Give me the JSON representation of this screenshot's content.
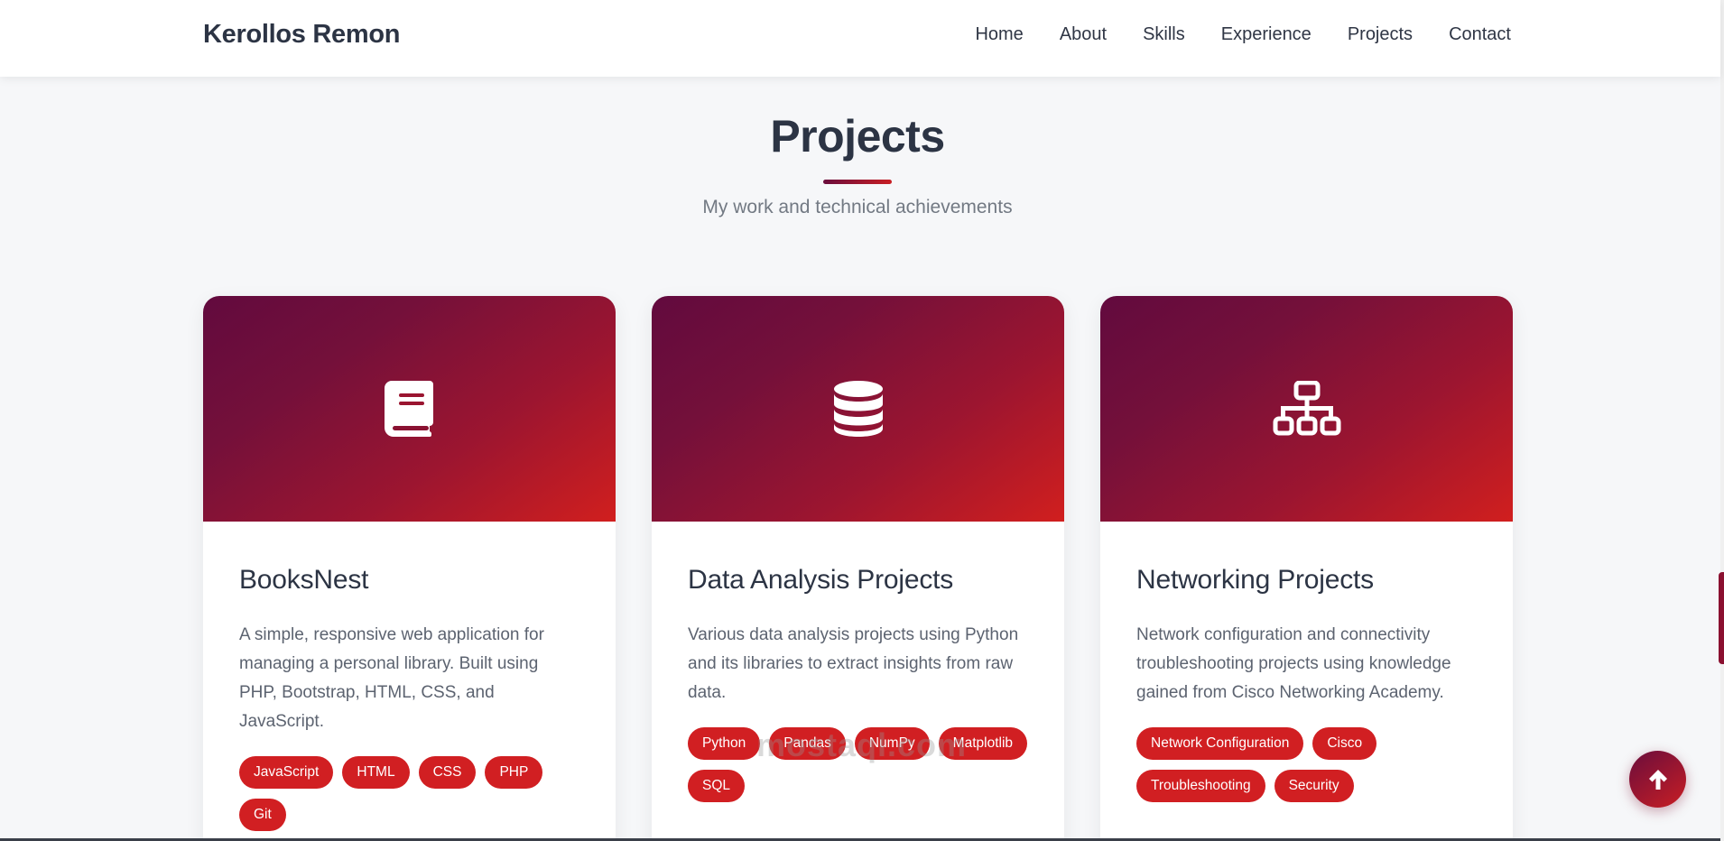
{
  "header": {
    "brand": "Kerollos Remon",
    "nav": [
      "Home",
      "About",
      "Skills",
      "Experience",
      "Projects",
      "Contact"
    ]
  },
  "section": {
    "title": "Projects",
    "subtitle": "My work and technical achievements"
  },
  "projects": [
    {
      "icon": "book-icon",
      "title": "BooksNest",
      "description": "A simple, responsive web application for managing a personal library. Built using PHP, Bootstrap, HTML, CSS, and JavaScript.",
      "tags": [
        "JavaScript",
        "HTML",
        "CSS",
        "PHP",
        "Git"
      ]
    },
    {
      "icon": "database-icon",
      "title": "Data Analysis Projects",
      "description": "Various data analysis projects using Python and its libraries to extract insights from raw data.",
      "tags": [
        "Python",
        "Pandas",
        "NumPy",
        "Matplotlib",
        "SQL"
      ]
    },
    {
      "icon": "network-icon",
      "title": "Networking Projects",
      "description": "Network configuration and connectivity troubleshooting projects using knowledge gained from Cisco Networking Academy.",
      "tags": [
        "Network Configuration",
        "Cisco",
        "Troubleshooting",
        "Security"
      ]
    }
  ],
  "watermark": "mostaql.com",
  "colors": {
    "accent": "#d11f22",
    "gradient_start": "#620a3e",
    "gradient_end": "#d11f1e",
    "text_dark": "#2c3444"
  },
  "back_to_top_icon": "arrow-up-icon"
}
